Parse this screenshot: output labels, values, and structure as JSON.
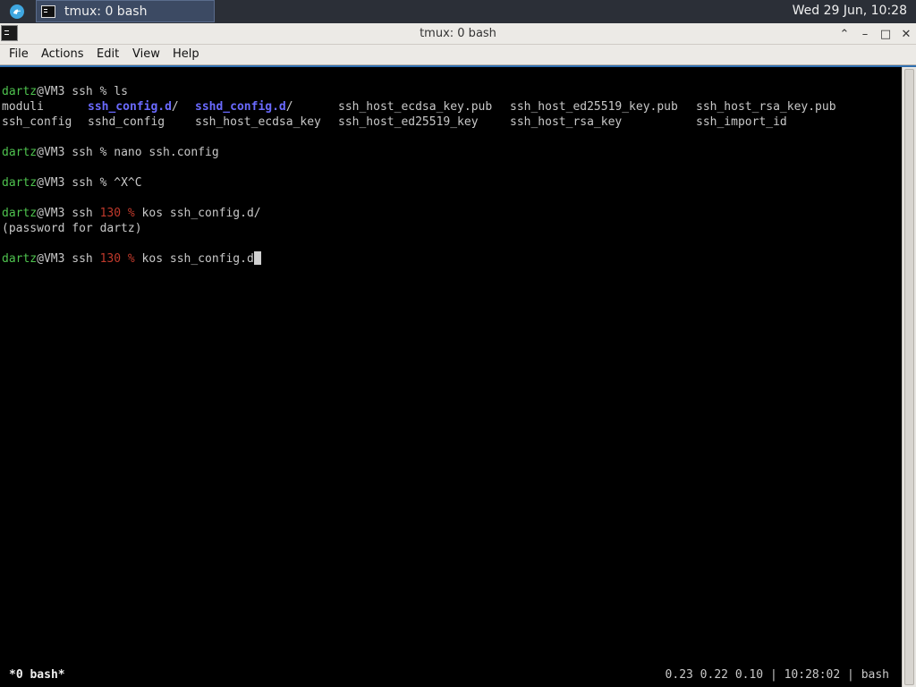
{
  "panel": {
    "taskbar_label": "tmux: 0 bash",
    "clock": "Wed 29 Jun, 10:28"
  },
  "window": {
    "title": "tmux: 0 bash",
    "controls": {
      "shade": "⌃",
      "minimize": "–",
      "maximize": "□",
      "close": "✕"
    }
  },
  "menubar": {
    "file": "File",
    "actions": "Actions",
    "edit": "Edit",
    "view": "View",
    "help": "Help"
  },
  "terminal": {
    "prompt_user": "dartz",
    "prompt_host": "@VM3 ssh ",
    "prompt_symbol": "%",
    "line1_cmd": " ls",
    "ls_row1": {
      "c1": "moduli",
      "c2": "ssh_config.d",
      "c2_suffix": "/",
      "c3": "sshd_config.d",
      "c3_suffix": "/",
      "c4": "ssh_host_ecdsa_key.pub",
      "c5": "ssh_host_ed25519_key.pub",
      "c6": "ssh_host_rsa_key.pub"
    },
    "ls_row2": {
      "c1": "ssh_config",
      "c2": "sshd_config",
      "c3": "ssh_host_ecdsa_key",
      "c4": "ssh_host_ed25519_key",
      "c5": "ssh_host_rsa_key",
      "c6": "ssh_import_id"
    },
    "line2_cmd": " nano ssh.config",
    "line3_cmd": " ^X^C",
    "exit_code": "130 ",
    "line4_cmd": " kos ssh_config.d/",
    "password_msg": "(password for dartz)",
    "line5_cmd": " kos ssh_config.d"
  },
  "tmux_status": {
    "left": "*0 bash*",
    "right": "0.23 0.22 0.10 | 10:28:02 | bash"
  },
  "colors": {
    "prompt_user": "#4ec24e",
    "exit_code": "#c0392b",
    "directory": "#6a6aff"
  }
}
